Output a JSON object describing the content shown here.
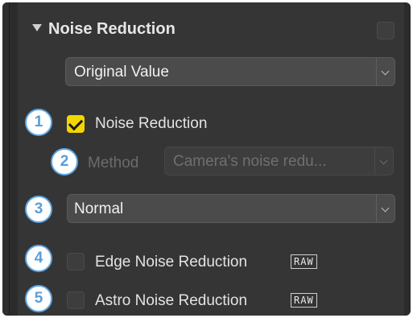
{
  "panel": {
    "title": "Noise Reduction",
    "preset": {
      "value": "Original Value"
    },
    "noise_reduction": {
      "label": "Noise Reduction",
      "checked": true
    },
    "method": {
      "label": "Method",
      "value": "Camera's noise redu..."
    },
    "strength": {
      "value": "Normal"
    },
    "edge_noise": {
      "label": "Edge Noise Reduction",
      "badge": "RAW",
      "checked": false
    },
    "astro_noise": {
      "label": "Astro Noise Reduction",
      "badge": "RAW",
      "checked": false
    }
  },
  "callouts": [
    "1",
    "2",
    "3",
    "4",
    "5"
  ],
  "colors": {
    "panel_bg": "#353535",
    "checkbox_on": "#f2d600",
    "callout_border": "#5da6e6"
  }
}
